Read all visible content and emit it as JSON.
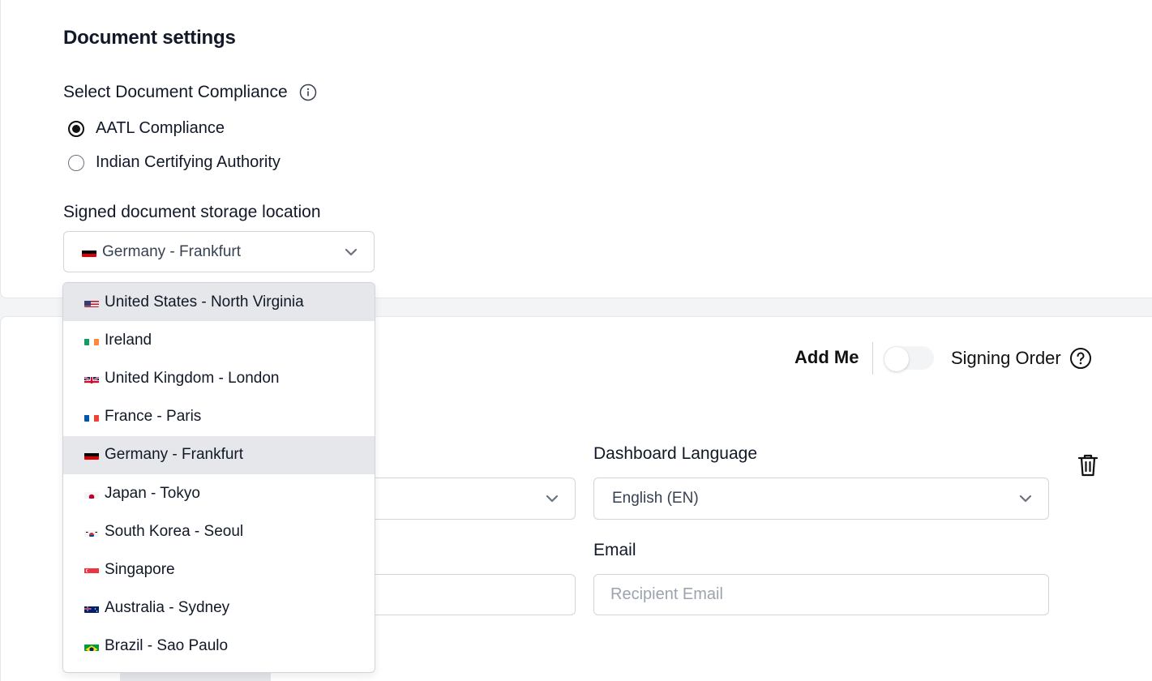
{
  "document_settings": {
    "title": "Document settings",
    "compliance_label": "Select Document Compliance",
    "compliance_options": [
      {
        "label": "AATL Compliance",
        "checked": true
      },
      {
        "label": "Indian Certifying Authority",
        "checked": false
      }
    ],
    "storage_label": "Signed document storage location",
    "storage_selected": "Germany - Frankfurt",
    "storage_options": [
      {
        "label": "United States - North Virginia",
        "flag": "us-flag"
      },
      {
        "label": "Ireland",
        "flag": "ie-flag"
      },
      {
        "label": "United Kingdom - London",
        "flag": "gb-flag"
      },
      {
        "label": "France - Paris",
        "flag": "fr-flag"
      },
      {
        "label": "Germany - Frankfurt",
        "flag": "de-flag"
      },
      {
        "label": "Japan - Tokyo",
        "flag": "jp-flag"
      },
      {
        "label": "South Korea - Seoul",
        "flag": "kr-flag"
      },
      {
        "label": "Singapore",
        "flag": "sg-flag"
      },
      {
        "label": "Australia - Sydney",
        "flag": "au-flag"
      },
      {
        "label": "Brazil - Sao Paulo",
        "flag": "br-flag"
      }
    ]
  },
  "recipients": {
    "add_me_label": "Add Me",
    "add_me_enabled": false,
    "signing_order_label": "Signing Order",
    "dashboard_language_label": "Dashboard Language",
    "dashboard_language_value": "English (EN)",
    "email_label": "Email",
    "email_placeholder": "Recipient Email"
  }
}
